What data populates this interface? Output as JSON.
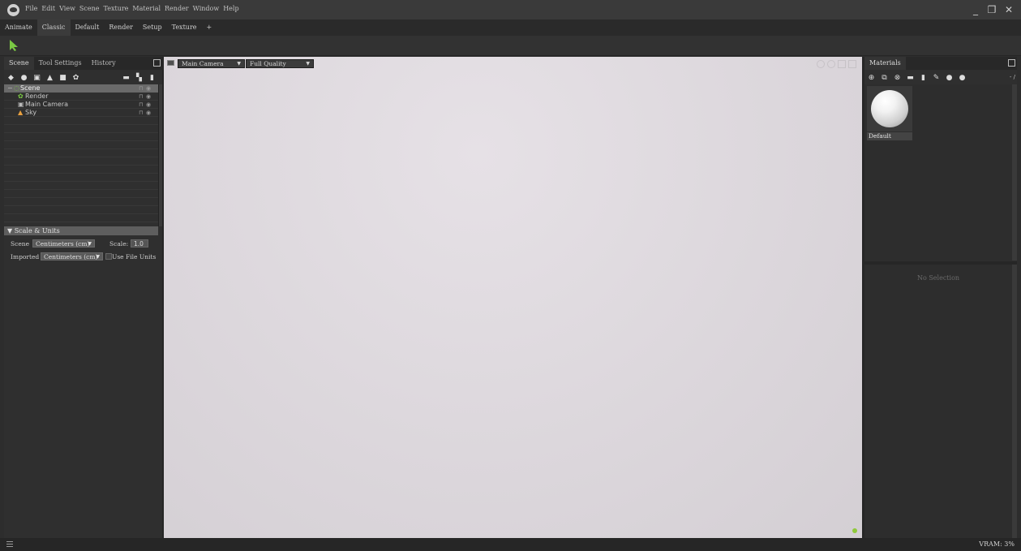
{
  "menubar": [
    "File",
    "Edit",
    "View",
    "Scene",
    "Texture",
    "Material",
    "Render",
    "Window",
    "Help"
  ],
  "window_controls": {
    "minimize": "_",
    "restore": "❐",
    "close": "✕"
  },
  "layout_tabs": [
    {
      "label": "Animate",
      "active": false
    },
    {
      "label": "Classic",
      "active": true
    },
    {
      "label": "Default",
      "active": false
    },
    {
      "label": "Render",
      "active": false
    },
    {
      "label": "Setup",
      "active": false
    },
    {
      "label": "Texture",
      "active": false
    },
    {
      "label": "+",
      "active": false
    }
  ],
  "left_panel": {
    "tabs": [
      {
        "label": "Scene",
        "active": true
      },
      {
        "label": "Tool Settings",
        "active": false
      },
      {
        "label": "History",
        "active": false
      }
    ],
    "tree": [
      {
        "label": "Scene",
        "selected": true
      },
      {
        "label": "Render",
        "selected": false
      },
      {
        "label": "Main Camera",
        "selected": false
      },
      {
        "label": "Sky",
        "selected": false
      }
    ],
    "scale_units": {
      "header": "▼ Scale & Units",
      "scene_label": "Scene",
      "scene_unit": "Centimeters (cm)",
      "scale_label": "Scale:",
      "scale_value": "1.0",
      "imported_label": "Imported",
      "imported_unit": "Centimeters (cm)",
      "use_file_units": "Use File Units"
    }
  },
  "viewport": {
    "camera": "Main Camera",
    "quality": "Full Quality",
    "status_color": "#8fc93a"
  },
  "right_panel": {
    "tab": "Materials",
    "page_indicator": "- /",
    "materials": [
      {
        "name": "Default"
      }
    ],
    "inspector_empty": "No Selection"
  },
  "status": {
    "vram": "VRAM: 3%"
  },
  "colors": {
    "accent_green": "#7ac943",
    "viewport_bg": "#dcd7dc"
  }
}
